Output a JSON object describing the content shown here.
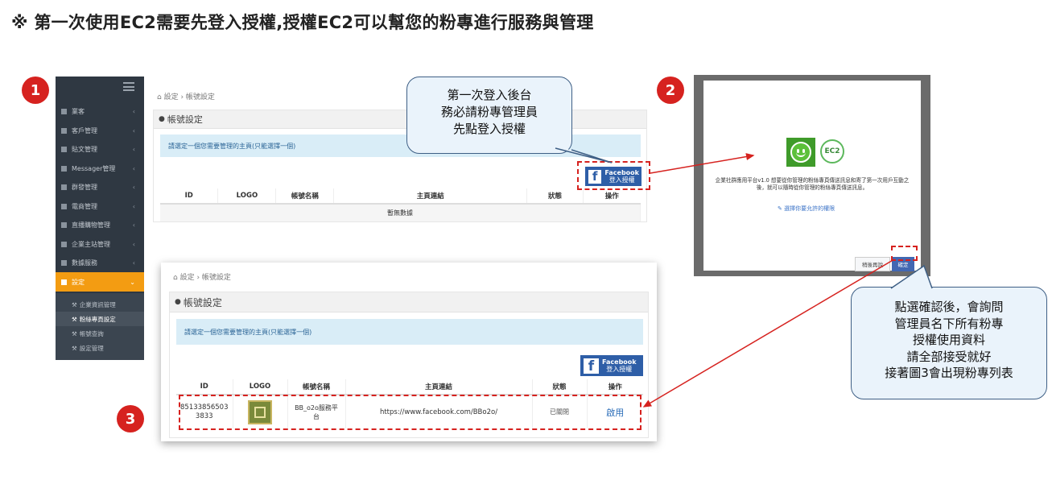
{
  "title": "※ 第一次使用EC2需要先登入授權,授權EC2可以幫您的粉專進行服務與管理",
  "badges": [
    "1",
    "2",
    "3"
  ],
  "colors": {
    "badge": "#d6221f",
    "sidebar": "#2f3842",
    "active": "#f39c12",
    "facebook": "#2e5ea7",
    "info_bar": "#d9edf7",
    "arrow": "#d6221f",
    "callout_bg": "#eaf3fb"
  },
  "sidebar": {
    "menu_icon": "hamburger-icon",
    "items": [
      {
        "label": "業客"
      },
      {
        "label": "客戶管理"
      },
      {
        "label": "貼文管理"
      },
      {
        "label": "Messager管理"
      },
      {
        "label": "群發管理"
      },
      {
        "label": "電商管理"
      },
      {
        "label": "直播購物管理"
      },
      {
        "label": "企業主站管理"
      },
      {
        "label": "數據服務"
      },
      {
        "label": "設定"
      }
    ],
    "sub_items": [
      {
        "label": "企業資訊管理"
      },
      {
        "label": "粉絲專頁設定"
      },
      {
        "label": "帳號查詢"
      },
      {
        "label": "設定管理"
      }
    ]
  },
  "screen1": {
    "breadcrumb": "設定 › 帳號設定",
    "panel_title": "帳號設定",
    "info": "請選定一個您需要管理的主頁(只能選擇一個)",
    "fb_button": {
      "line1": "Facebook",
      "line2": "登入授權"
    },
    "columns": [
      "ID",
      "LOGO",
      "帳號名稱",
      "主頁連結",
      "狀態",
      "操作"
    ],
    "empty": "暫無數據"
  },
  "callout1": {
    "lines": [
      "第一次登入後台",
      "務必請粉專管理員",
      "先點登入授權"
    ]
  },
  "dialog": {
    "text": "企業社群應用平台v1.0 想要從你管理的粉絲專頁傳送訊息和寄了第一次用戶互動之後，就可以隨時從你管理的粉絲專頁傳送訊息。",
    "link": "選擇你要允許的權限",
    "cancel": "稍後再說",
    "confirm": "確定",
    "logo_text": "EC2"
  },
  "callout2": {
    "lines": [
      "點選確認後，會詢問",
      "管理員名下所有粉專",
      "授權使用資料",
      "請全部接受就好",
      "接著圖3會出現粉專列表"
    ]
  },
  "screen3": {
    "breadcrumb": "設定 › 帳號設定",
    "panel_title": "帳號設定",
    "info": "請選定一個您需要管理的主頁(只能選擇一個)",
    "fb_button": {
      "line1": "Facebook",
      "line2": "登入授權"
    },
    "columns": [
      "ID",
      "LOGO",
      "帳號名稱",
      "主頁連結",
      "狀態",
      "操作"
    ],
    "row": {
      "id_line1": "85133856503",
      "id_line2": "3833",
      "name_line1": "BB_o2o服務平",
      "name_line2": "台",
      "link": "https://www.facebook.com/BBo2o/",
      "status": "已關閉",
      "action": "啟用"
    }
  }
}
